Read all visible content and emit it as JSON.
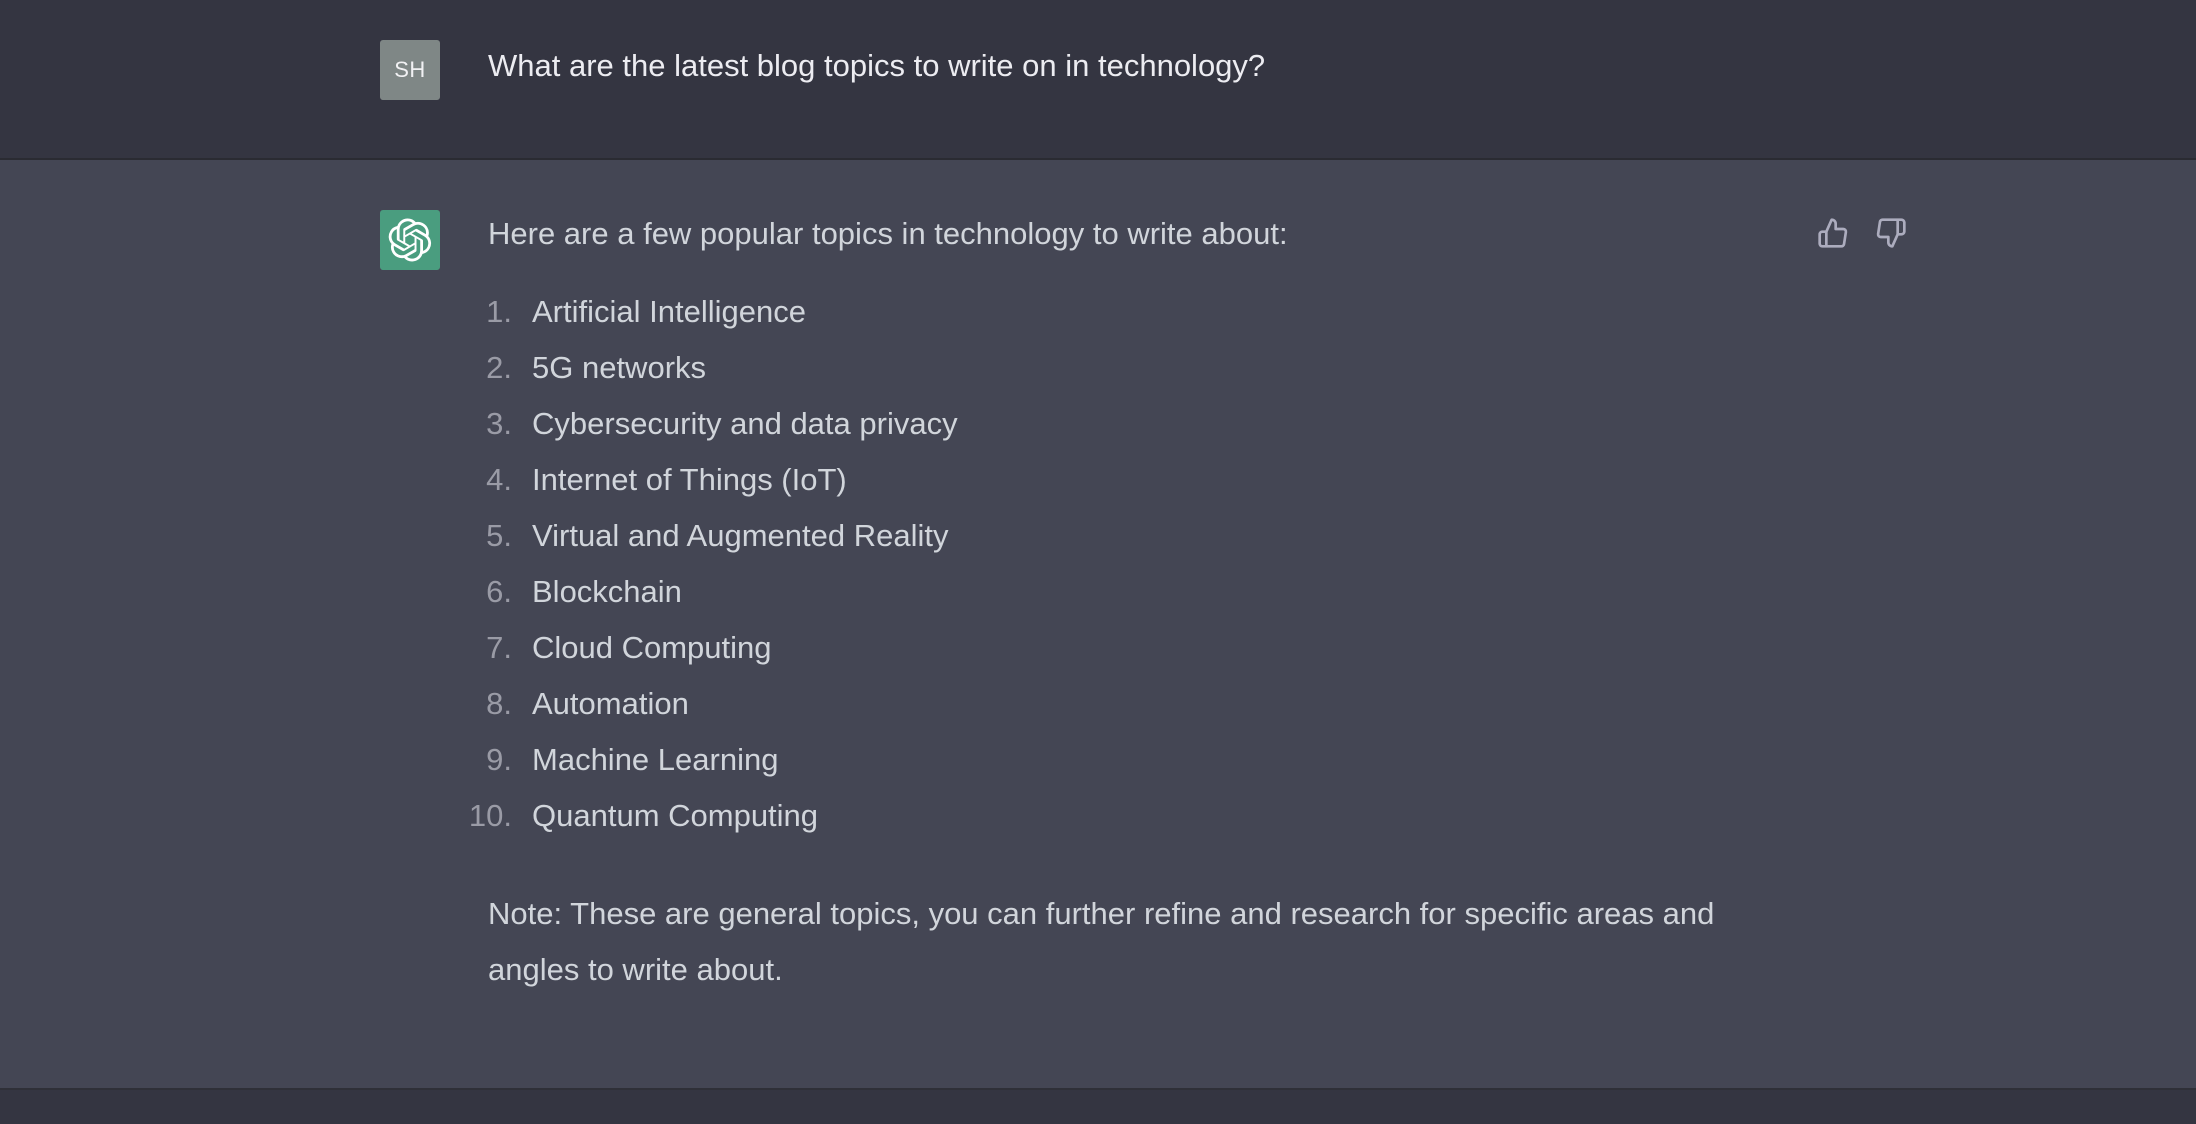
{
  "conversation": {
    "user_message": {
      "avatar_initials": "SH",
      "text": "What are the latest blog topics to write on in technology?"
    },
    "assistant_message": {
      "avatar_icon": "openai-logo-icon",
      "intro": "Here are a few popular topics in technology to write about:",
      "topics": [
        {
          "number": "1.",
          "label": "Artificial Intelligence"
        },
        {
          "number": "2.",
          "label": "5G networks"
        },
        {
          "number": "3.",
          "label": "Cybersecurity and data privacy"
        },
        {
          "number": "4.",
          "label": "Internet of Things (IoT)"
        },
        {
          "number": "5.",
          "label": "Virtual and Augmented Reality"
        },
        {
          "number": "6.",
          "label": "Blockchain"
        },
        {
          "number": "7.",
          "label": "Cloud Computing"
        },
        {
          "number": "8.",
          "label": "Automation"
        },
        {
          "number": "9.",
          "label": "Machine Learning"
        },
        {
          "number": "10.",
          "label": "Quantum Computing"
        }
      ],
      "note": "Note: These are general topics, you can further refine and research for specific areas and angles to write about.",
      "feedback": {
        "thumbs_up_icon": "thumbs-up-icon",
        "thumbs_down_icon": "thumbs-down-icon"
      }
    }
  },
  "colors": {
    "user_row_bg": "#343541",
    "assistant_row_bg": "#444654",
    "bot_avatar_bg": "#4a9d7f",
    "user_avatar_bg": "#7f8786",
    "text_primary": "#ececf1",
    "text_secondary": "#d1d5db",
    "list_number": "#9a9ba6"
  }
}
